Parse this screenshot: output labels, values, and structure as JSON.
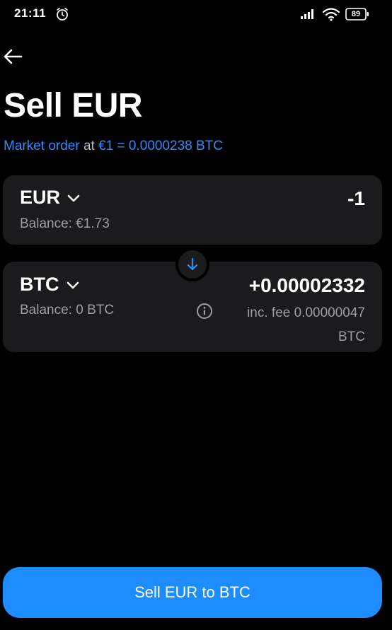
{
  "status_bar": {
    "time": "21:11",
    "battery": "89",
    "icons": [
      "alarm-icon",
      "signal-icon",
      "wifi-icon",
      "battery-icon"
    ]
  },
  "header": {
    "back_icon": "arrow-left-icon",
    "title": "Sell EUR"
  },
  "market": {
    "order_type": "Market order",
    "at": "at",
    "rate": "€1 = 0.0000238 BTC"
  },
  "from": {
    "currency": "EUR",
    "amount": "-1",
    "balance": "Balance: €1.73"
  },
  "to": {
    "currency": "BTC",
    "amount": "+0.00002332",
    "balance": "Balance: 0 BTC",
    "fee": "inc. fee 0.00000047 BTC"
  },
  "action": {
    "label": "Sell EUR to BTC"
  },
  "colors": {
    "background": "#000000",
    "card": "#1b1b1d",
    "accent": "#2f8cff",
    "button": "#1c8cfe",
    "muted_text": "#9b9ea5"
  }
}
